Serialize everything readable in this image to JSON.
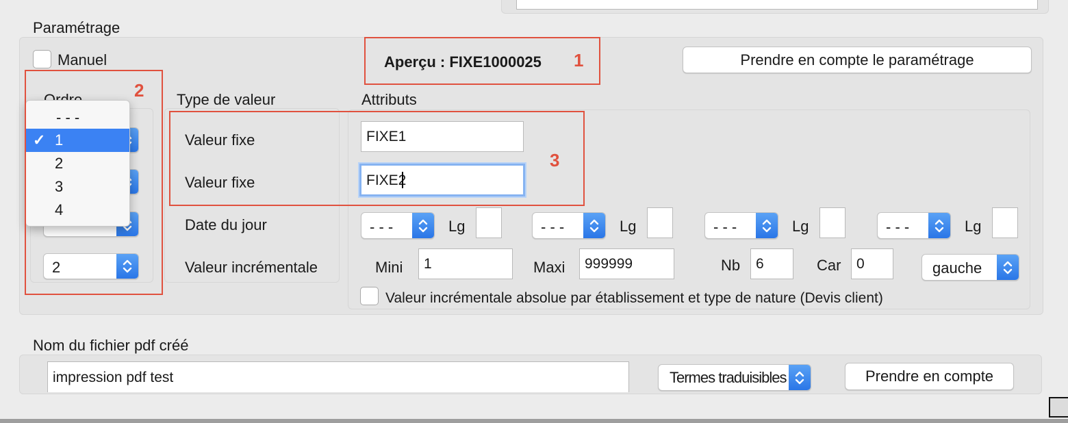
{
  "settings": {
    "section_title": "Paramétrage",
    "manual_label": "Manuel",
    "preview_text": "Aperçu : FIXE1000025",
    "apply_button": "Prendre en compte le paramétrage",
    "order_header": "Ordre",
    "type_header": "Type de valeur",
    "attributes_header": "Attributs",
    "order_selects": [
      "---",
      "---",
      "---",
      "2"
    ],
    "order_menu": {
      "items": [
        "- - -",
        "1",
        "2",
        "3",
        "4"
      ],
      "selected": "1",
      "checkmark": "✓"
    },
    "value_types": [
      "Valeur fixe",
      "Valeur fixe",
      "Date du jour",
      "Valeur incrémentale"
    ],
    "fixed1_value": "FIXE1",
    "fixed2_value": "FIXE2",
    "date_selects": [
      "- - -",
      "- - -",
      "- - -",
      "- - -"
    ],
    "lg_label": "Lg",
    "increment": {
      "mini_label": "Mini",
      "mini_value": "1",
      "maxi_label": "Maxi",
      "maxi_value": "999999",
      "nb_label": "Nb",
      "nb_value": "6",
      "car_label": "Car",
      "car_value": "0",
      "align_value": "gauche"
    },
    "absolute_increment_label": "Valeur incrémentale absolue par établissement et type de nature (Devis client)"
  },
  "annotations": {
    "n1": "1",
    "n2": "2",
    "n3": "3",
    "color": "#e0513e"
  },
  "pdf": {
    "section_title": "Nom du fichier pdf créé",
    "filename_value": "impression pdf test",
    "terms_select": "Termes traduisibles",
    "apply_button": "Prendre en compte"
  },
  "colors": {
    "accent": "#3b82f3",
    "annotation": "#e0513e"
  }
}
